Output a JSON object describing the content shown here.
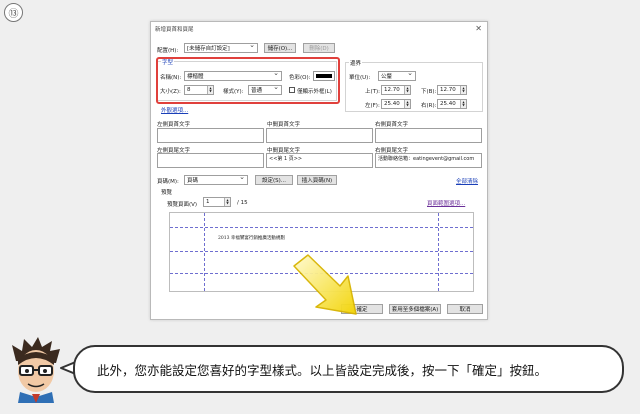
{
  "step_number": "⑬",
  "dialog": {
    "title": "新增頁首和頁尾",
    "close_glyph": "✕",
    "profile": {
      "label": "配置(H):",
      "value": "[未儲存自訂設定]",
      "save_button": "儲存(O)...",
      "delete_button": "刪除(D)"
    },
    "font": {
      "group_label": "字型",
      "name_label": "名稱(N):",
      "name_value": "標楷體",
      "size_label": "大小(Z):",
      "size_value": "8",
      "style_label": "樣式(Y):",
      "style_value": "普通",
      "color_label": "色彩(O):",
      "color_value": "#000000",
      "outline_only_label": "僅顯示外框(L)",
      "underline_link": "外觀選項..."
    },
    "margins": {
      "group_label": "邊界",
      "unit_label": "單位(U):",
      "unit_value": "公釐",
      "top_label": "上(T):",
      "top_value": "12.70",
      "bottom_label": "下(B):",
      "bottom_value": "12.70",
      "left_label": "左(F):",
      "left_value": "25.40",
      "right_label": "右(R):",
      "right_value": "25.40"
    },
    "header_footer": {
      "left_header_label": "左側頁首文字",
      "center_header_label": "中間頁首文字",
      "right_header_label": "右側頁首文字",
      "left_footer_label": "左側頁尾文字",
      "center_footer_label": "中間頁尾文字",
      "right_footer_label": "右側頁尾文字",
      "center_footer_value": "<<第 1 頁>>",
      "right_footer_value": "活動聯絡信箱：eatingevent@gmail.com"
    },
    "insert": {
      "page_label": "頁碼(M):",
      "page_value": "頁碼",
      "settings_button": "設定(S)...",
      "insert_button": "插入頁碼(N)",
      "clear_all_link": "全部清除"
    },
    "preview": {
      "group_label": "預覽",
      "page_label": "預覽頁面(V)",
      "page_value": "1",
      "total_pages": "/   15",
      "range_link": "頁面範圍選項...",
      "preview_text": "2013 幸福饗宴行銷推廣活動規劃"
    },
    "buttons": {
      "ok": "確定",
      "save_multiple": "套用至多個檔案(A)",
      "cancel": "取消"
    }
  },
  "caption": "此外，您亦能設定您喜好的字型樣式。以上皆設定完成後，按一下「確定」按鈕。"
}
